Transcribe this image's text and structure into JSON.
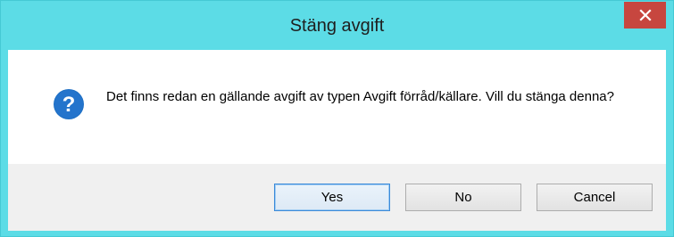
{
  "dialog": {
    "title": "Stäng avgift",
    "message": "Det finns redan en gällande avgift av typen Avgift förråd/källare. Vill du stänga denna?",
    "icon": "question-icon",
    "buttons": {
      "yes": "Yes",
      "no": "No",
      "cancel": "Cancel"
    },
    "close_icon": "close-icon"
  },
  "colors": {
    "titlebar": "#5cdce6",
    "close_button": "#c7463f",
    "question_icon": "#1e6fc4",
    "button_area": "#f0f0f0"
  }
}
